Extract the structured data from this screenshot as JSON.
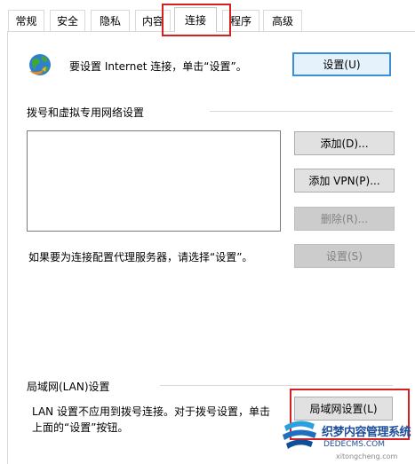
{
  "tabs": [
    {
      "label": "常规"
    },
    {
      "label": "安全"
    },
    {
      "label": "隐私"
    },
    {
      "label": "内容"
    },
    {
      "label": "连接"
    },
    {
      "label": "程序"
    },
    {
      "label": "高级"
    }
  ],
  "active_tab": "连接",
  "setup": {
    "text": "要设置 Internet 连接，单击“设置”。",
    "button": "设置(U)"
  },
  "dialup": {
    "heading": "拨号和虚拟专用网络设置",
    "add_button": "添加(D)...",
    "add_vpn_button": "添加 VPN(P)...",
    "delete_button": "删除(R)...",
    "proxy_text": "如果要为连接配置代理服务器，请选择“设置”。",
    "settings_button": "设置(S)"
  },
  "lan": {
    "heading": "局域网(LAN)设置",
    "text_line1": "LAN 设置不应用到拨号连接。对于拨号设置，单击",
    "text_line2": "上面的“设置”按钮。",
    "button": "局域网设置(L)"
  },
  "watermark": {
    "line1": "织梦内容管理系统",
    "line2": "DEDECMS.COM",
    "line3": "xitongcheng.com"
  },
  "colors": {
    "highlight": "#d6201f",
    "primary_border": "#3b8fd9",
    "watermark": "#1f4f9a"
  }
}
